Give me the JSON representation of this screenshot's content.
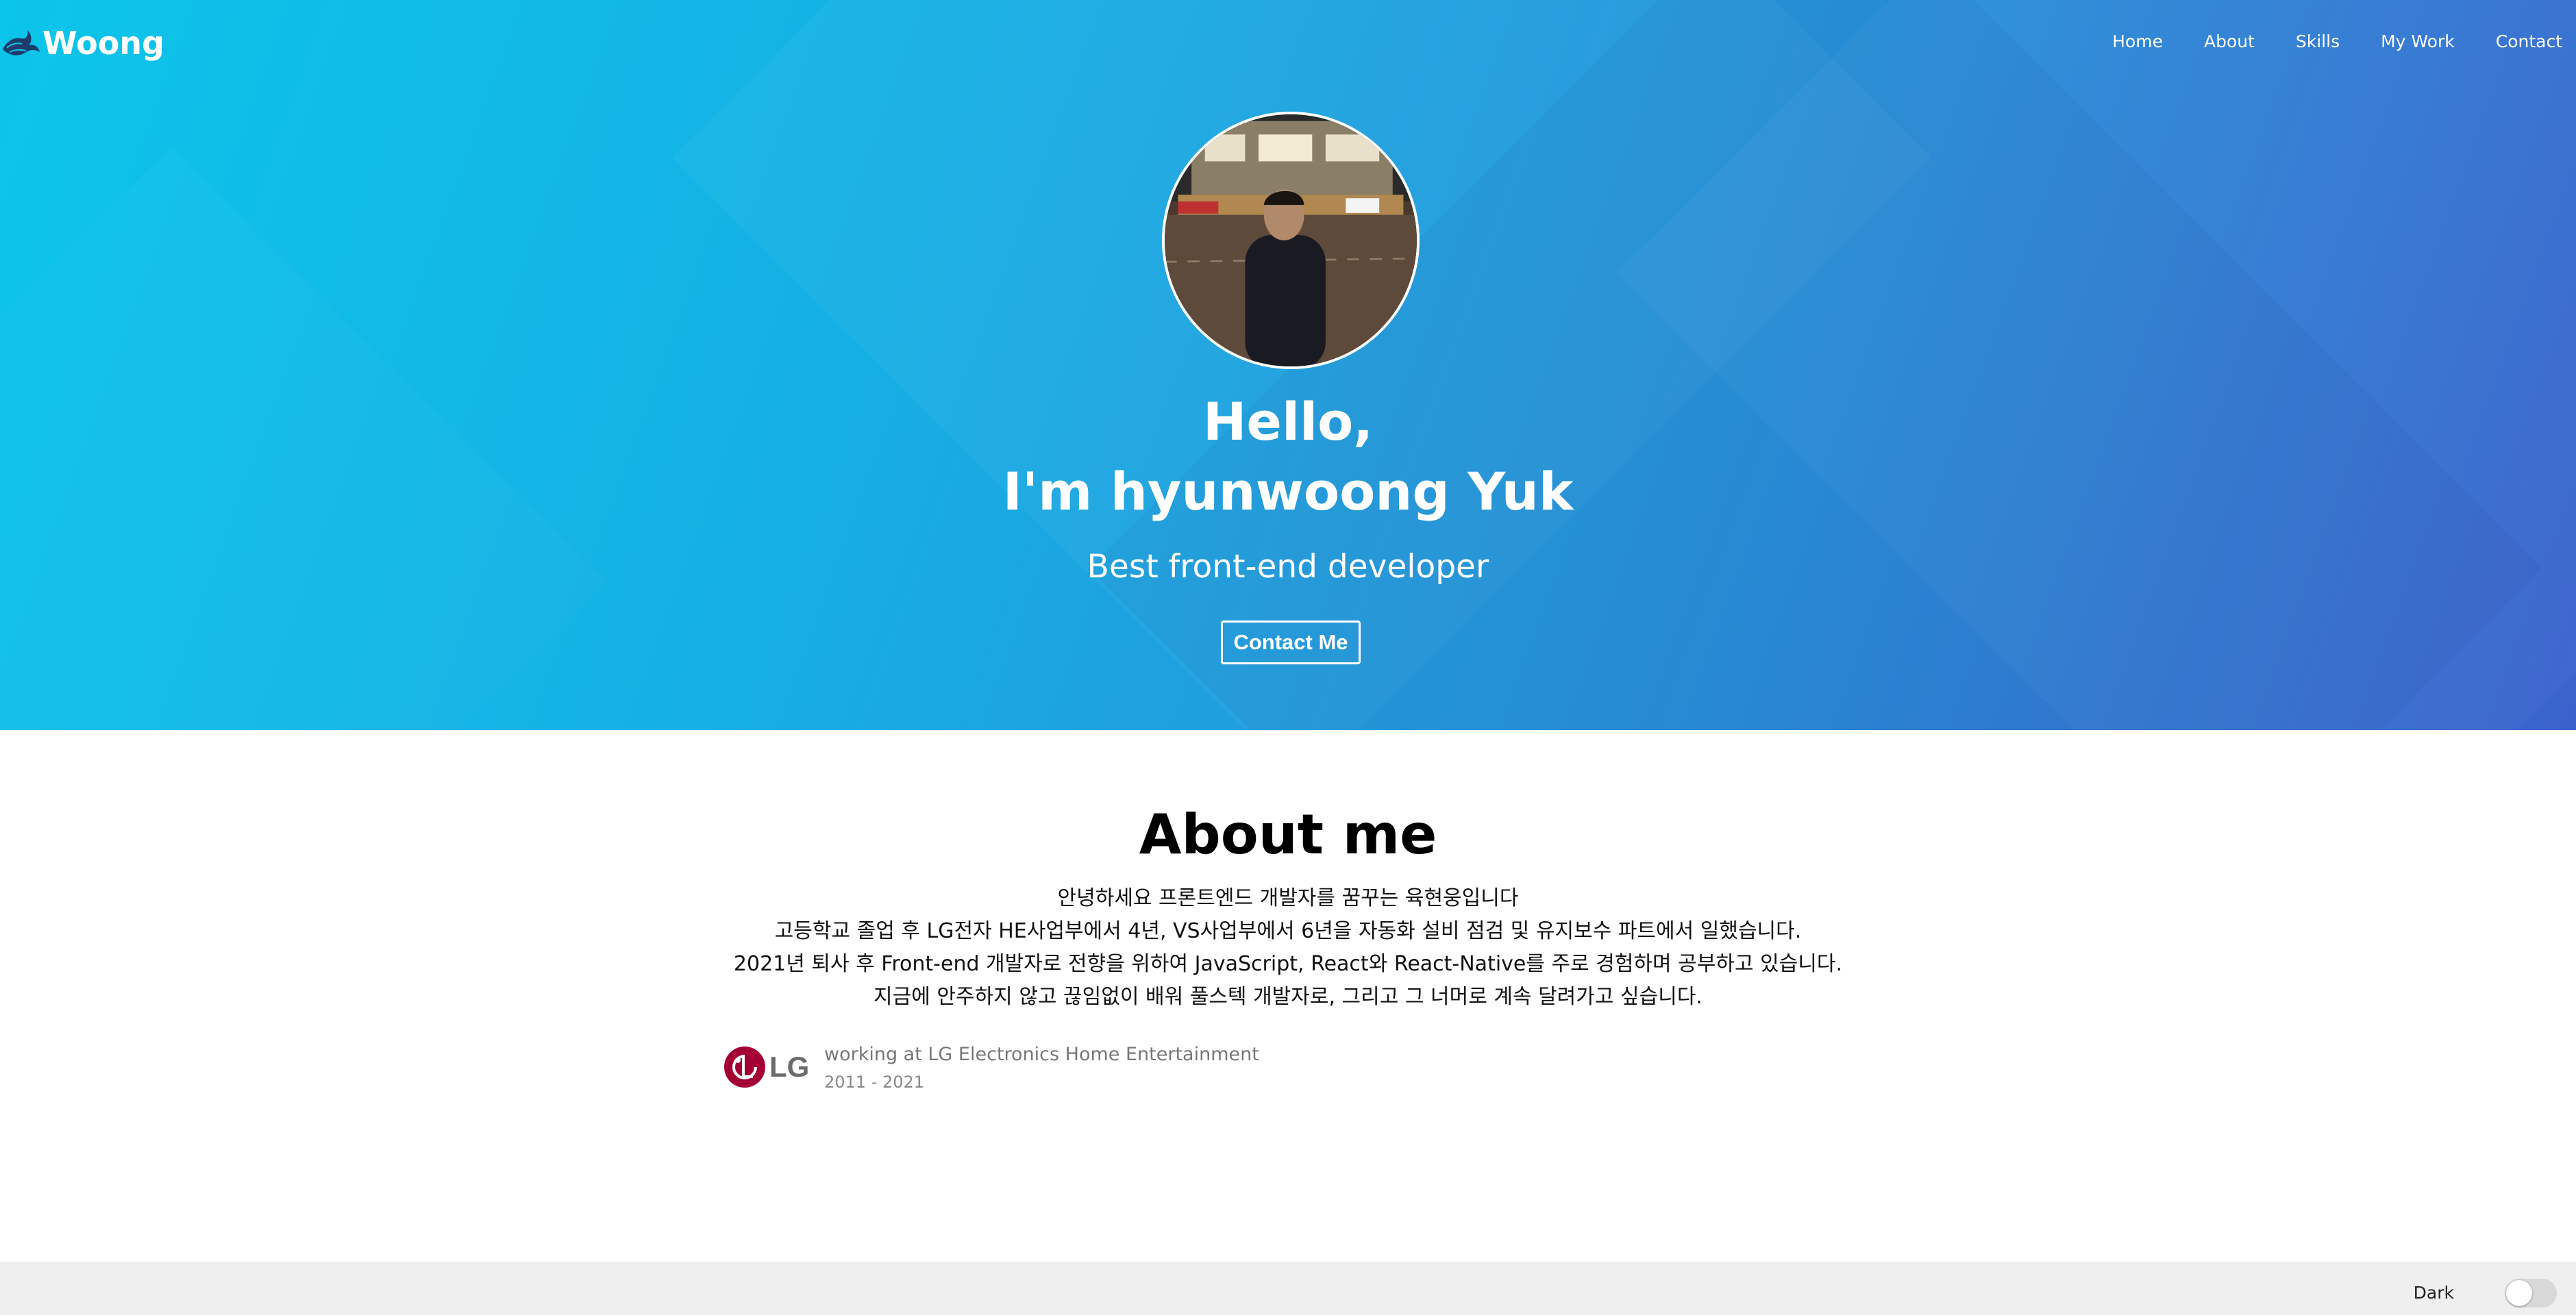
{
  "brand": {
    "name": "Woong",
    "icon": "wave-dragon-icon"
  },
  "nav": {
    "items": [
      {
        "label": "Home"
      },
      {
        "label": "About"
      },
      {
        "label": "Skills"
      },
      {
        "label": "My Work"
      },
      {
        "label": "Contact"
      }
    ]
  },
  "hero": {
    "greeting": "Hello,",
    "name_line": "I'm hyunwoong Yuk",
    "subtitle": "Best front-end developer",
    "contact_button": "Contact Me",
    "colors": {
      "gradient_start": "#0cc5ea",
      "gradient_end": "#3a62cc"
    }
  },
  "about": {
    "title": "About me",
    "paragraphs": [
      "안녕하세요 프론트엔드 개발자를 꿈꾸는 육현웅입니다",
      "고등학교 졸업 후 LG전자 HE사업부에서 4년, VS사업부에서 6년을 자동화 설비 점검 및 유지보수 파트에서 일했습니다.",
      "2021년 퇴사 후 Front-end 개발자로 전향을 위하여 JavaScript, React와 React-Native를 주로 경험하며 공부하고 있습니다.",
      "지금에 안주하지 않고 끊임없이 배워 풀스텍 개발자로, 그리고 그 너머로 계속 달려가고 싶습니다."
    ],
    "job": {
      "company_logo": "lg-logo",
      "logo_text": "LG",
      "title": "working at LG Electronics Home Entertainment",
      "years": "2011 - 2021"
    }
  },
  "footer": {
    "dark_mode_label": "Dark",
    "dark_mode_enabled": false
  }
}
